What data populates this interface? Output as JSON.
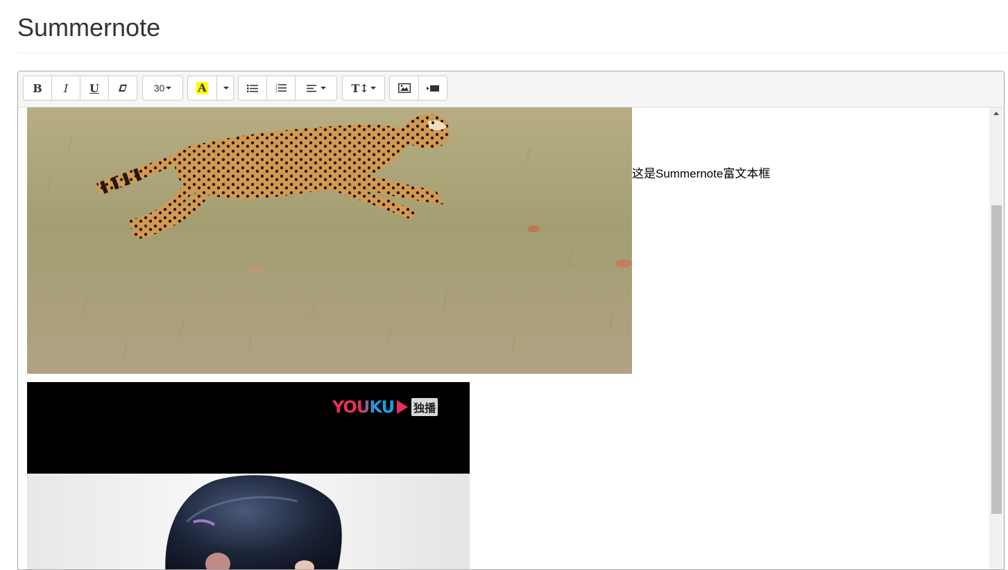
{
  "page": {
    "title": "Summernote"
  },
  "toolbar": {
    "bold_label": "B",
    "italic_label": "I",
    "underline_label": "U",
    "font_size_value": "30",
    "highlight_label": "A",
    "highlight_color": "#ffff00",
    "font_style_label": "T↕"
  },
  "icons": {
    "bold": "bold-icon",
    "italic": "italic-icon",
    "underline": "underline-icon",
    "clear_format": "eraser-icon",
    "color": "font-color-icon",
    "unordered_list": "unordered-list-icon",
    "ordered_list": "ordered-list-icon",
    "align": "align-left-icon",
    "line_height": "text-height-icon",
    "picture": "picture-icon",
    "video": "video-icon"
  },
  "content": {
    "caption": "这是Summernote富文本框",
    "video_watermark": {
      "brand": "YOUKU",
      "badge": "独播"
    }
  },
  "colors": {
    "editor_border": "#a9a9a9",
    "toolbar_bg": "#f5f5f5",
    "youku_pink": "#e8305a",
    "youku_blue": "#1aa0e8"
  }
}
